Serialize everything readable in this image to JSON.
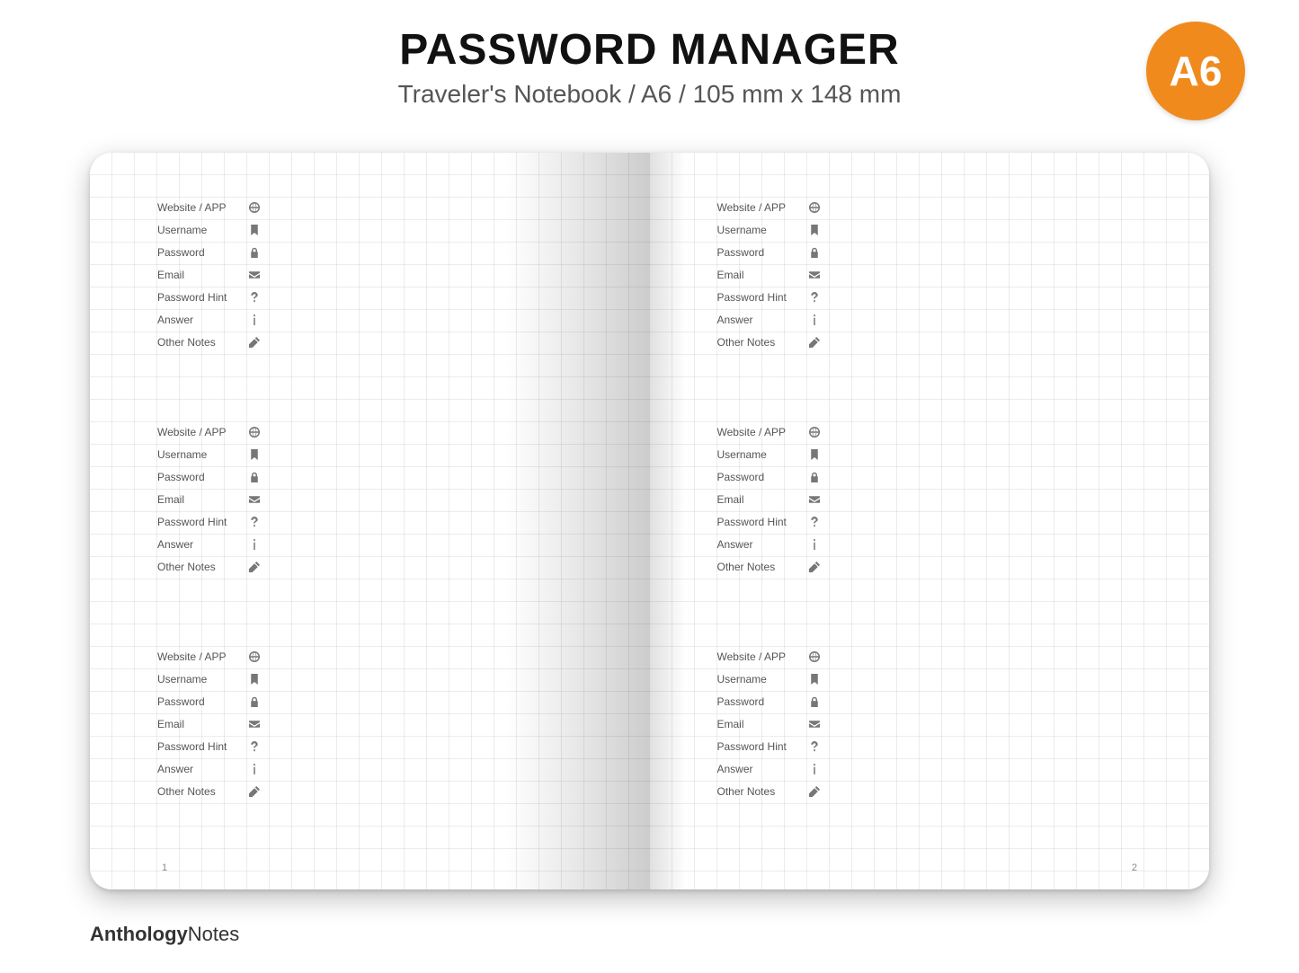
{
  "header": {
    "title": "PASSWORD MANAGER",
    "subtitle": "Traveler's Notebook / A6  /  105 mm x 148 mm"
  },
  "badge": {
    "label": "A6",
    "color": "#f08a1d"
  },
  "fields": [
    {
      "label": "Website / APP",
      "icon": "globe-icon"
    },
    {
      "label": "Username",
      "icon": "bookmark-icon"
    },
    {
      "label": "Password",
      "icon": "lock-icon"
    },
    {
      "label": "Email",
      "icon": "envelope-icon"
    },
    {
      "label": "Password Hint",
      "icon": "question-icon"
    },
    {
      "label": "Answer",
      "icon": "info-icon"
    },
    {
      "label": "Other Notes",
      "icon": "pencil-icon"
    }
  ],
  "pages": {
    "left": {
      "number": "1",
      "entry_count": 3
    },
    "right": {
      "number": "2",
      "entry_count": 3
    }
  },
  "brand": {
    "bold": "Anthology",
    "light": "Notes"
  }
}
